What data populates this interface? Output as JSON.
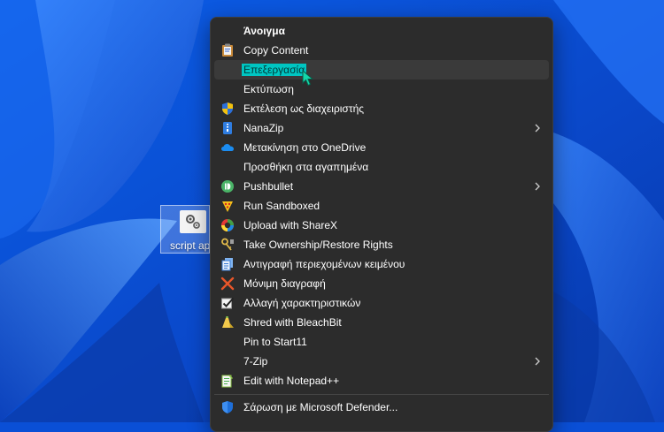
{
  "desktop": {
    "icon_label": "script ap"
  },
  "menu": {
    "items": [
      {
        "label": "Άνοιγμα",
        "icon": "none",
        "bold": true
      },
      {
        "label": "Copy Content",
        "icon": "clipboard-icon"
      },
      {
        "label": "Επεξεργασία",
        "icon": "none",
        "highlighted": true
      },
      {
        "label": "Εκτύπωση",
        "icon": "none"
      },
      {
        "label": "Εκτέλεση ως διαχειριστής",
        "icon": "uac-shield-icon"
      },
      {
        "label": "NanaZip",
        "icon": "nanazip-icon",
        "submenu": true
      },
      {
        "label": "Μετακίνηση στο OneDrive",
        "icon": "onedrive-icon"
      },
      {
        "label": "Προσθήκη στα αγαπημένα",
        "icon": "none"
      },
      {
        "label": "Pushbullet",
        "icon": "pushbullet-icon",
        "submenu": true
      },
      {
        "label": "Run Sandboxed",
        "icon": "sandboxie-icon"
      },
      {
        "label": "Upload with ShareX",
        "icon": "sharex-icon"
      },
      {
        "label": "Take Ownership/Restore Rights",
        "icon": "ownership-key-icon"
      },
      {
        "label": "Αντιγραφή περιεχομένων κειμένου",
        "icon": "copy-text-icon"
      },
      {
        "label": "Μόνιμη διαγραφή",
        "icon": "delete-x-icon"
      },
      {
        "label": "Αλλαγή χαρακτηριστικών",
        "icon": "attributes-icon"
      },
      {
        "label": "Shred with BleachBit",
        "icon": "bleachbit-icon"
      },
      {
        "label": "Pin to Start11",
        "icon": "none"
      },
      {
        "label": "7-Zip",
        "icon": "none",
        "submenu": true
      },
      {
        "label": "Edit with Notepad++",
        "icon": "notepadpp-icon"
      },
      {
        "label": "Σάρωση με Microsoft Defender...",
        "icon": "defender-shield-icon"
      }
    ]
  },
  "colors": {
    "menu_bg": "#2c2c2c",
    "hover_bg": "#3a3a3a",
    "selection": "#00c6c2",
    "wallpaper_blue": "#0a4fd6"
  }
}
